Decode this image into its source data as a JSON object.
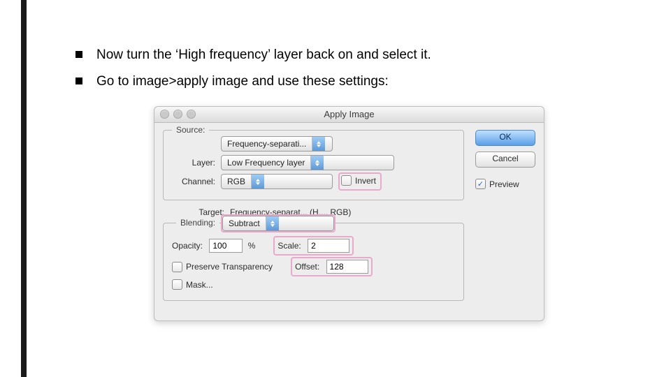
{
  "bullets": [
    "Now turn the ‘High frequency’ layer back on and select it.",
    "Go to image>apply image and use these settings:"
  ],
  "dialog": {
    "title": "Apply Image",
    "source_legend": "Source:",
    "source_value": "Frequency-separati...",
    "layer_label": "Layer:",
    "layer_value": "Low Frequency layer",
    "channel_label": "Channel:",
    "channel_value": "RGB",
    "invert_label": "Invert",
    "target_label": "Target:",
    "target_value": "Frequency-separat... (H..., RGB)",
    "blending_label": "Blending:",
    "blending_value": "Subtract",
    "opacity_label": "Opacity:",
    "opacity_value": "100",
    "opacity_pct": "%",
    "scale_label": "Scale:",
    "scale_value": "2",
    "preserve_label": "Preserve Transparency",
    "offset_label": "Offset:",
    "offset_value": "128",
    "mask_label": "Mask...",
    "ok": "OK",
    "cancel": "Cancel",
    "preview_label": "Preview",
    "preview_checked": true
  }
}
